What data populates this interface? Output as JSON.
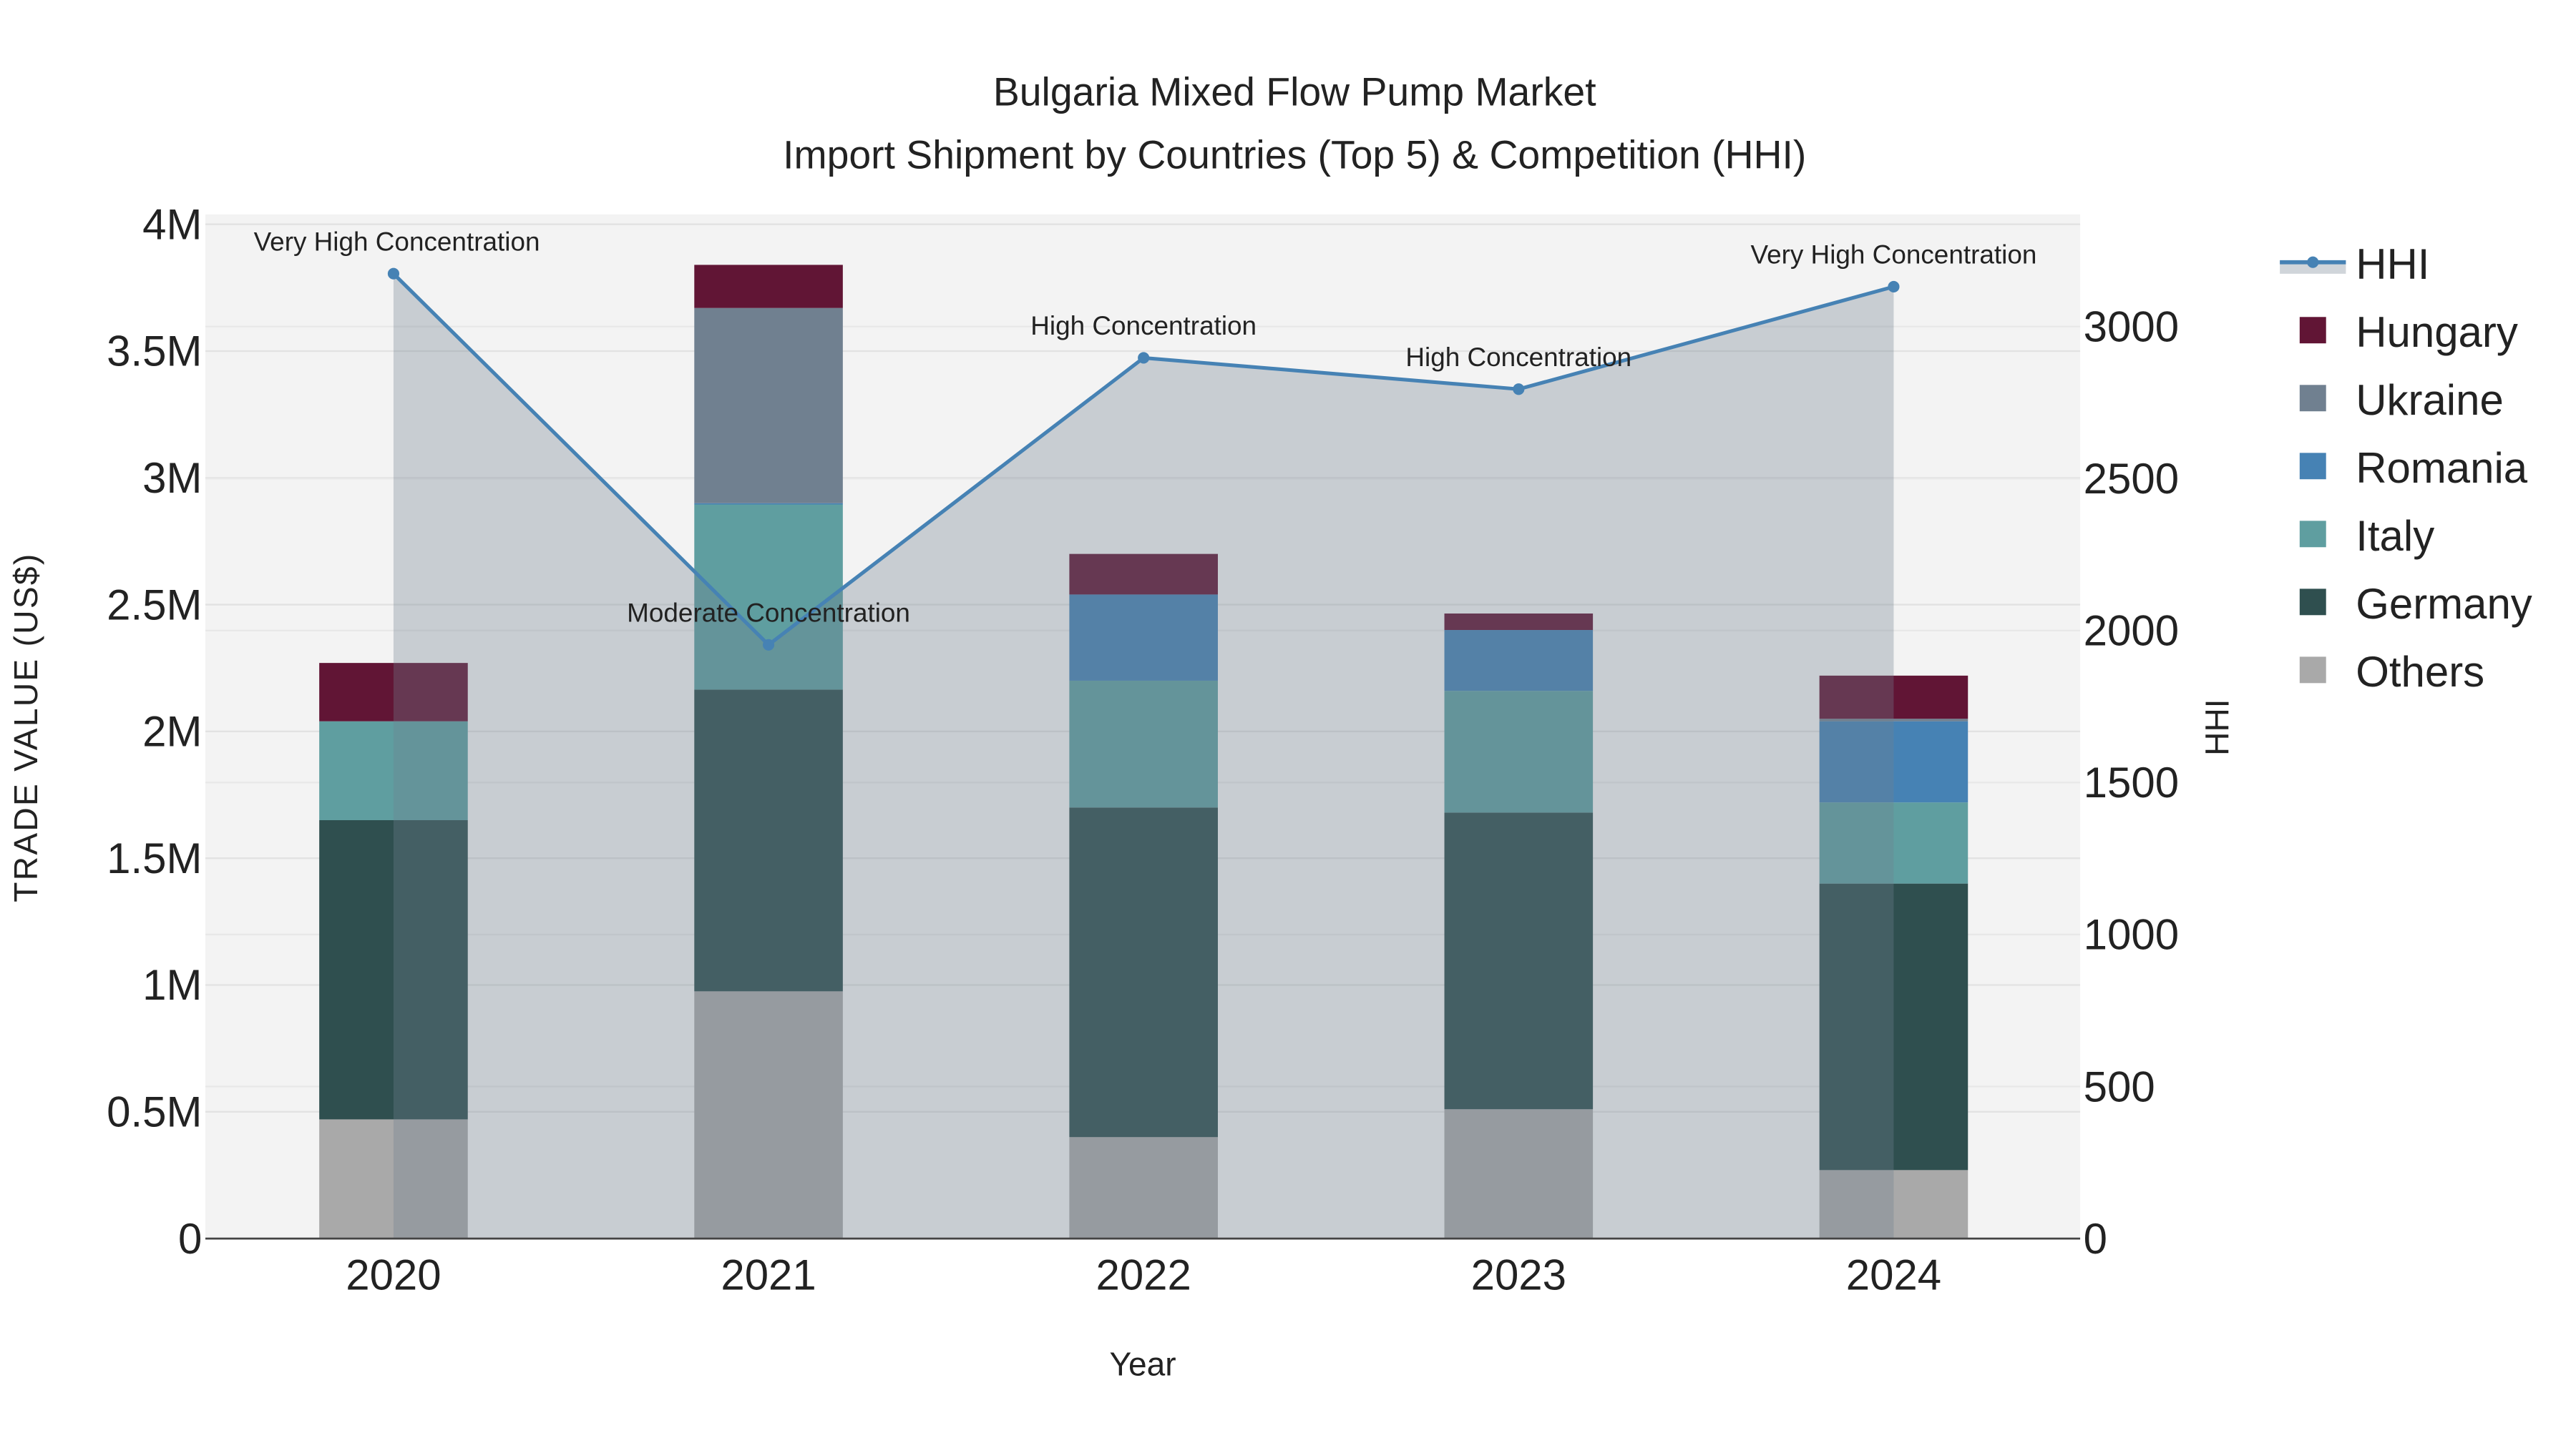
{
  "chart_data": {
    "type": "bar",
    "title_line1": "Bulgaria Mixed Flow Pump Market",
    "title_line2": "Import Shipment by Countries (Top 5) & Competition (HHI)",
    "xlabel": "Year",
    "ylabel": "TRADE VALUE (US$)",
    "y2label": "HHI",
    "categories": [
      "2020",
      "2021",
      "2022",
      "2023",
      "2024"
    ],
    "ylim": [
      0,
      4000000
    ],
    "y_ticks": [
      0,
      500000,
      1000000,
      1500000,
      2000000,
      2500000,
      3000000,
      3500000,
      4000000
    ],
    "y_tick_labels": [
      "0",
      "0.5M",
      "1M",
      "1.5M",
      "2M",
      "2.5M",
      "3M",
      "3.5M",
      "4M"
    ],
    "y2lim": [
      0,
      3400
    ],
    "y2_ticks": [
      0,
      500,
      1000,
      1500,
      2000,
      2500,
      3000
    ],
    "y2_tick_labels": [
      "0",
      "500",
      "1000",
      "1500",
      "2000",
      "2500",
      "3000"
    ],
    "series": [
      {
        "name": "Others",
        "color": "#a9a9a9",
        "values": [
          470000,
          975000,
          400000,
          510000,
          270000
        ]
      },
      {
        "name": "Germany",
        "color": "#2f4f4f",
        "values": [
          1180000,
          1190000,
          1300000,
          1170000,
          1130000
        ]
      },
      {
        "name": "Italy",
        "color": "#5f9ea0",
        "values": [
          390000,
          730000,
          500000,
          480000,
          320000
        ]
      },
      {
        "name": "Romania",
        "color": "#4682b4",
        "values": [
          0,
          5000,
          340000,
          240000,
          320000
        ]
      },
      {
        "name": "Ukraine",
        "color": "#708090",
        "values": [
          0,
          770000,
          0,
          0,
          10000
        ]
      },
      {
        "name": "Hungary",
        "color": "#611535",
        "values": [
          230000,
          170000,
          160000,
          65000,
          170000
        ]
      }
    ],
    "hhi": {
      "name": "HHI",
      "color": "#4682b4",
      "values": [
        3174,
        1953,
        2897,
        2794,
        3131
      ],
      "annotations": [
        "Very High Concentration",
        "Moderate Concentration",
        "High Concentration",
        "High Concentration",
        "Very High Concentration"
      ]
    },
    "legend_order": [
      "HHI",
      "Hungary",
      "Ukraine",
      "Romania",
      "Italy",
      "Germany",
      "Others"
    ],
    "legend_placement": "right",
    "grid": true
  }
}
